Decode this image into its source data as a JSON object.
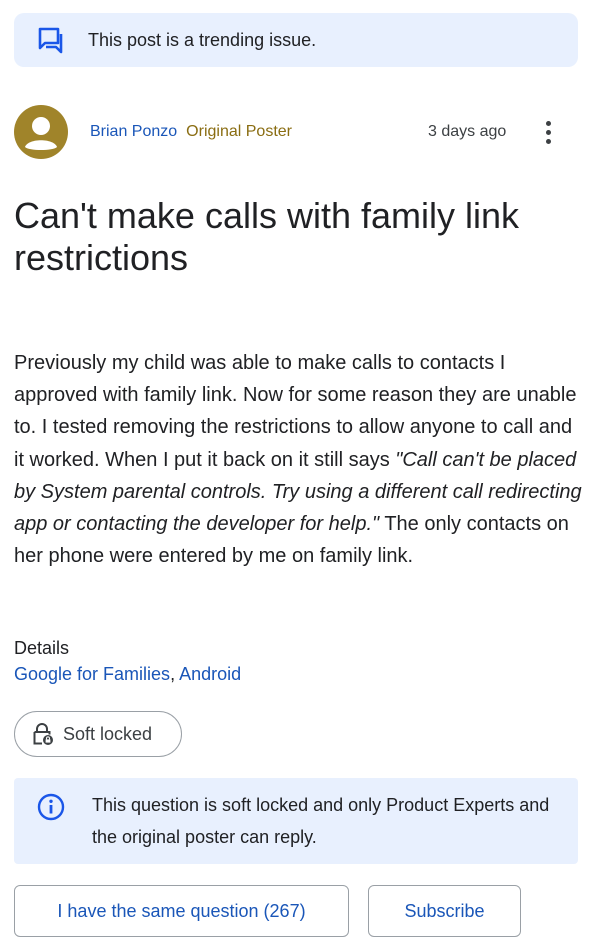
{
  "trending": {
    "text": "This post is a trending issue.",
    "icon": "forum-icon"
  },
  "author": {
    "name": "Brian Ponzo",
    "badge": "Original Poster",
    "time": "3 days ago"
  },
  "post": {
    "title": "Can't make calls with family link restrictions",
    "body_before": "Previously my child was able to make calls to contacts I approved with family link. Now for some reason they are unable to. I tested removing the restrictions to allow anyone to call and it worked. When I put it back on it still says ",
    "body_quote": "\"Call can't be placed by System parental controls. Try using a different call redirecting app or contacting the developer for help.\"",
    "body_after": " The only contacts on her phone were entered by me on family link."
  },
  "details": {
    "label": "Details",
    "links": [
      "Google for Families",
      "Android"
    ],
    "separator": ", "
  },
  "chip": {
    "label": "Soft locked",
    "icon": "lock-icon"
  },
  "info": {
    "text": "This question is soft locked and only Product Experts and the original poster can reply.",
    "icon": "info-icon"
  },
  "actions": {
    "same_question": "I have the same question (267)",
    "subscribe": "Subscribe"
  },
  "colors": {
    "link": "#1a56b8",
    "badge": "#8a6d12",
    "banner_bg": "#e8f0fe",
    "avatar": "#a0842a"
  }
}
